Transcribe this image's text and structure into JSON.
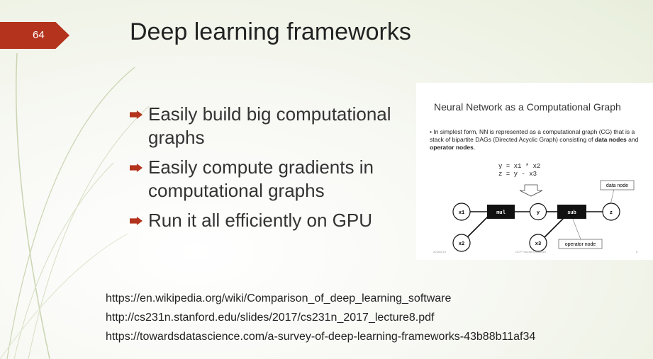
{
  "slide": {
    "number": "64",
    "title": "Deep learning frameworks",
    "bullets": [
      "Easily build big computational graphs",
      "Easily compute gradients in computational graphs",
      "Run it all efficiently on GPU"
    ],
    "links": [
      "https://en.wikipedia.org/wiki/Comparison_of_deep_learning_software",
      "http://cs231n.stanford.edu/slides/2017/cs231n_2017_lecture8.pdf",
      "https://towardsdatascience.com/a-survey-of-deep-learning-frameworks-43b88b11af34"
    ],
    "accent_color": "#b3331d"
  },
  "figure": {
    "title": "Neural Network as a Computational Graph",
    "desc_prefix": "In simplest form, NN is represented as a computational graph (CG) that is a stack of bipartite DAGs (Directed Acyclic Graph) consisting of ",
    "desc_bold1": "data nodes",
    "desc_and": " and ",
    "desc_bold2": "operator nodes",
    "desc_end": ".",
    "eq1": "y = x1 * x2",
    "eq2": "z = y - x3",
    "nodes": {
      "x1": "x1",
      "x2": "x2",
      "x3": "x3",
      "y": "y",
      "z": "z",
      "mul": "mul",
      "sub": "sub"
    },
    "callout_data": "data node",
    "callout_operator": "operator node",
    "footer_left": "2016/2/19",
    "footer_mid": "GCP Tutorial Kyoto2016",
    "footer_right": "8"
  }
}
